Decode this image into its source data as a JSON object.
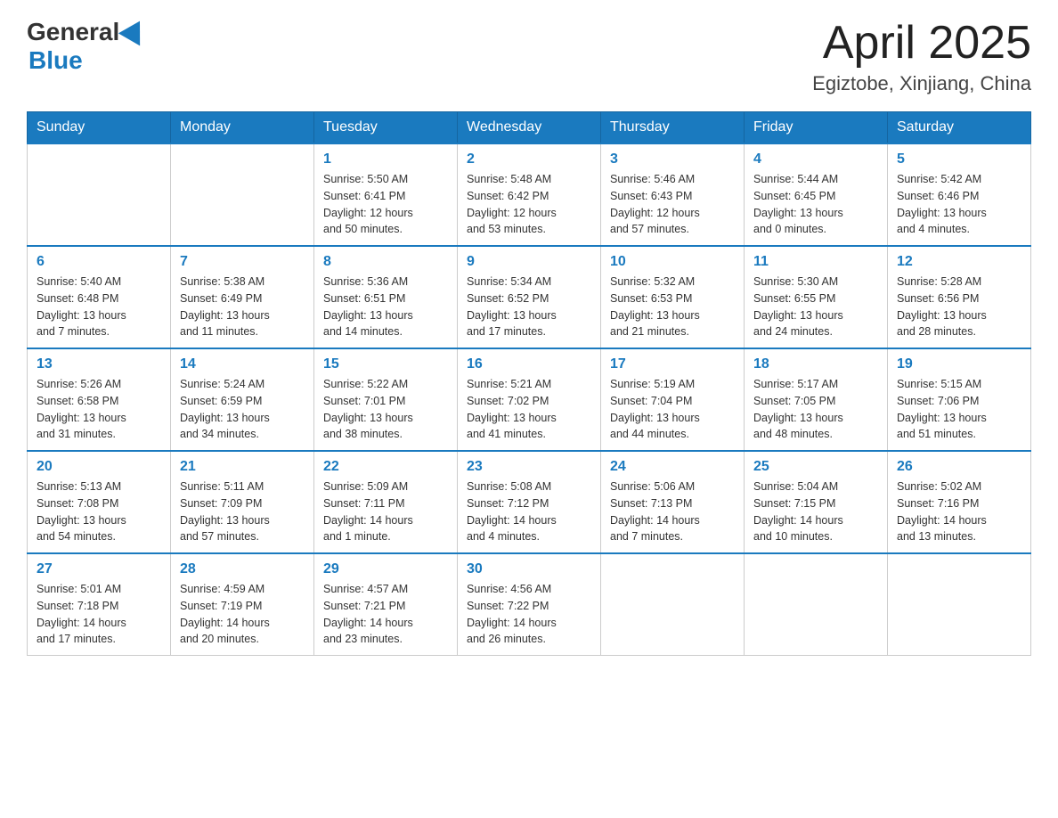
{
  "header": {
    "logo_general": "General",
    "logo_blue": "Blue",
    "title": "April 2025",
    "subtitle": "Egiztobe, Xinjiang, China"
  },
  "calendar": {
    "days_of_week": [
      "Sunday",
      "Monday",
      "Tuesday",
      "Wednesday",
      "Thursday",
      "Friday",
      "Saturday"
    ],
    "weeks": [
      [
        {
          "day": "",
          "info": ""
        },
        {
          "day": "",
          "info": ""
        },
        {
          "day": "1",
          "info": "Sunrise: 5:50 AM\nSunset: 6:41 PM\nDaylight: 12 hours\nand 50 minutes."
        },
        {
          "day": "2",
          "info": "Sunrise: 5:48 AM\nSunset: 6:42 PM\nDaylight: 12 hours\nand 53 minutes."
        },
        {
          "day": "3",
          "info": "Sunrise: 5:46 AM\nSunset: 6:43 PM\nDaylight: 12 hours\nand 57 minutes."
        },
        {
          "day": "4",
          "info": "Sunrise: 5:44 AM\nSunset: 6:45 PM\nDaylight: 13 hours\nand 0 minutes."
        },
        {
          "day": "5",
          "info": "Sunrise: 5:42 AM\nSunset: 6:46 PM\nDaylight: 13 hours\nand 4 minutes."
        }
      ],
      [
        {
          "day": "6",
          "info": "Sunrise: 5:40 AM\nSunset: 6:48 PM\nDaylight: 13 hours\nand 7 minutes."
        },
        {
          "day": "7",
          "info": "Sunrise: 5:38 AM\nSunset: 6:49 PM\nDaylight: 13 hours\nand 11 minutes."
        },
        {
          "day": "8",
          "info": "Sunrise: 5:36 AM\nSunset: 6:51 PM\nDaylight: 13 hours\nand 14 minutes."
        },
        {
          "day": "9",
          "info": "Sunrise: 5:34 AM\nSunset: 6:52 PM\nDaylight: 13 hours\nand 17 minutes."
        },
        {
          "day": "10",
          "info": "Sunrise: 5:32 AM\nSunset: 6:53 PM\nDaylight: 13 hours\nand 21 minutes."
        },
        {
          "day": "11",
          "info": "Sunrise: 5:30 AM\nSunset: 6:55 PM\nDaylight: 13 hours\nand 24 minutes."
        },
        {
          "day": "12",
          "info": "Sunrise: 5:28 AM\nSunset: 6:56 PM\nDaylight: 13 hours\nand 28 minutes."
        }
      ],
      [
        {
          "day": "13",
          "info": "Sunrise: 5:26 AM\nSunset: 6:58 PM\nDaylight: 13 hours\nand 31 minutes."
        },
        {
          "day": "14",
          "info": "Sunrise: 5:24 AM\nSunset: 6:59 PM\nDaylight: 13 hours\nand 34 minutes."
        },
        {
          "day": "15",
          "info": "Sunrise: 5:22 AM\nSunset: 7:01 PM\nDaylight: 13 hours\nand 38 minutes."
        },
        {
          "day": "16",
          "info": "Sunrise: 5:21 AM\nSunset: 7:02 PM\nDaylight: 13 hours\nand 41 minutes."
        },
        {
          "day": "17",
          "info": "Sunrise: 5:19 AM\nSunset: 7:04 PM\nDaylight: 13 hours\nand 44 minutes."
        },
        {
          "day": "18",
          "info": "Sunrise: 5:17 AM\nSunset: 7:05 PM\nDaylight: 13 hours\nand 48 minutes."
        },
        {
          "day": "19",
          "info": "Sunrise: 5:15 AM\nSunset: 7:06 PM\nDaylight: 13 hours\nand 51 minutes."
        }
      ],
      [
        {
          "day": "20",
          "info": "Sunrise: 5:13 AM\nSunset: 7:08 PM\nDaylight: 13 hours\nand 54 minutes."
        },
        {
          "day": "21",
          "info": "Sunrise: 5:11 AM\nSunset: 7:09 PM\nDaylight: 13 hours\nand 57 minutes."
        },
        {
          "day": "22",
          "info": "Sunrise: 5:09 AM\nSunset: 7:11 PM\nDaylight: 14 hours\nand 1 minute."
        },
        {
          "day": "23",
          "info": "Sunrise: 5:08 AM\nSunset: 7:12 PM\nDaylight: 14 hours\nand 4 minutes."
        },
        {
          "day": "24",
          "info": "Sunrise: 5:06 AM\nSunset: 7:13 PM\nDaylight: 14 hours\nand 7 minutes."
        },
        {
          "day": "25",
          "info": "Sunrise: 5:04 AM\nSunset: 7:15 PM\nDaylight: 14 hours\nand 10 minutes."
        },
        {
          "day": "26",
          "info": "Sunrise: 5:02 AM\nSunset: 7:16 PM\nDaylight: 14 hours\nand 13 minutes."
        }
      ],
      [
        {
          "day": "27",
          "info": "Sunrise: 5:01 AM\nSunset: 7:18 PM\nDaylight: 14 hours\nand 17 minutes."
        },
        {
          "day": "28",
          "info": "Sunrise: 4:59 AM\nSunset: 7:19 PM\nDaylight: 14 hours\nand 20 minutes."
        },
        {
          "day": "29",
          "info": "Sunrise: 4:57 AM\nSunset: 7:21 PM\nDaylight: 14 hours\nand 23 minutes."
        },
        {
          "day": "30",
          "info": "Sunrise: 4:56 AM\nSunset: 7:22 PM\nDaylight: 14 hours\nand 26 minutes."
        },
        {
          "day": "",
          "info": ""
        },
        {
          "day": "",
          "info": ""
        },
        {
          "day": "",
          "info": ""
        }
      ]
    ]
  }
}
